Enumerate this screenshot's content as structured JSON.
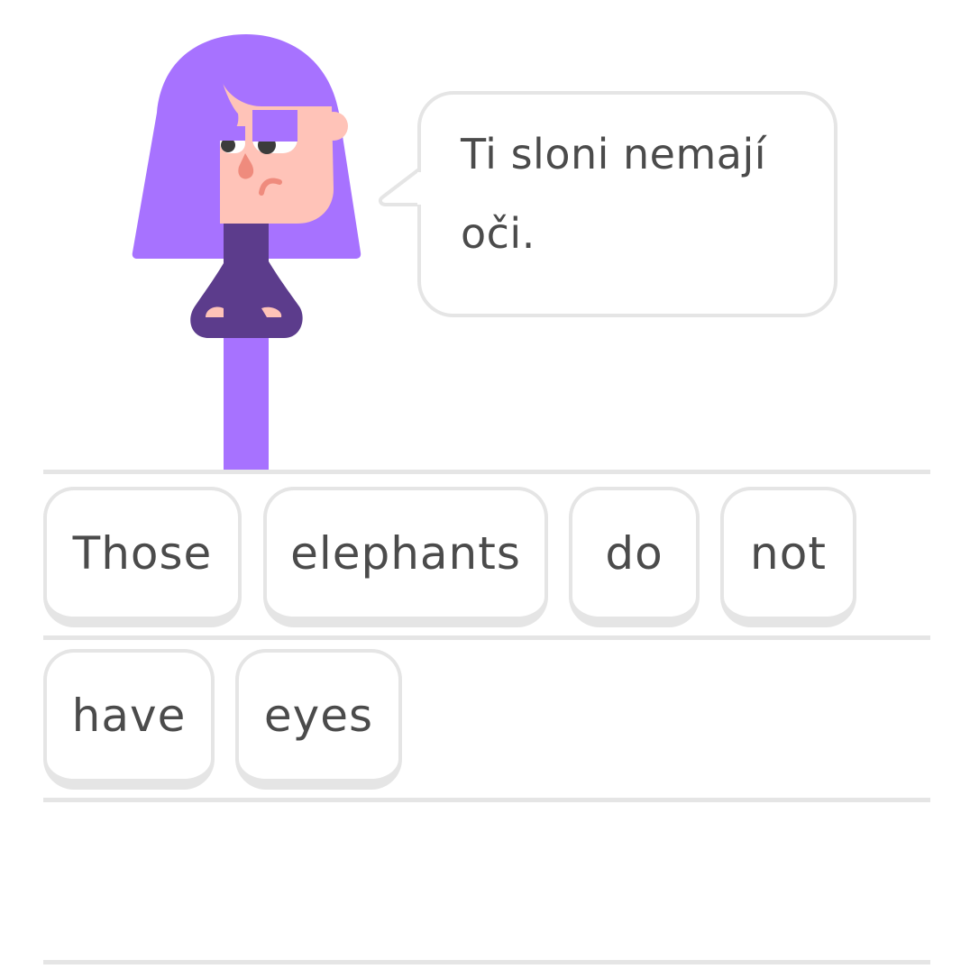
{
  "speech_bubble": {
    "text": "Ti sloni nemají oči."
  },
  "answer_area": {
    "rows": [
      {
        "tiles": [
          {
            "label": "Those"
          },
          {
            "label": "elephants"
          },
          {
            "label": "do"
          },
          {
            "label": "not"
          }
        ]
      },
      {
        "tiles": [
          {
            "label": "have"
          },
          {
            "label": "eyes"
          }
        ]
      }
    ]
  },
  "colors": {
    "hair": "#a772ff",
    "skin": "#ffc3b8",
    "shirt": "#5c3c8c",
    "text": "#4b4b4b",
    "border": "#e5e5e5",
    "nose": "#ef8b7d"
  },
  "character": {
    "icon": "lily-character-icon"
  }
}
